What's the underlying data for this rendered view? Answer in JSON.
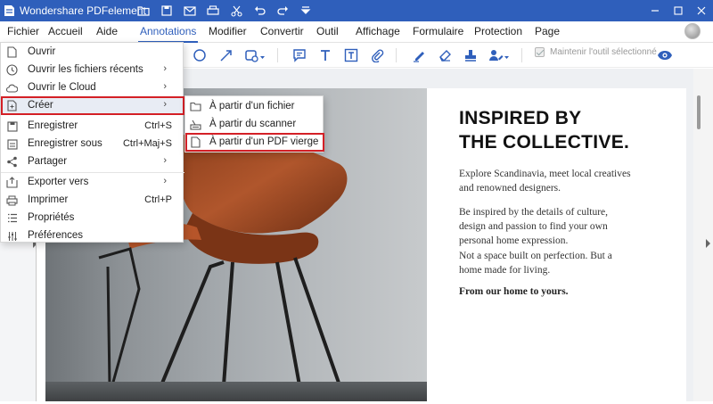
{
  "window": {
    "title": "Wondershare PDFelement"
  },
  "menubar": {
    "items": [
      "Fichier",
      "Accueil",
      "Aide",
      "Annotations",
      "Modifier",
      "Convertir",
      "Outil",
      "Affichage",
      "Formulaire",
      "Protection",
      "Page"
    ],
    "active": "Annotations"
  },
  "toolbar": {
    "keep_tool_label": "Maintenir l'outil sélectionné",
    "tools": [
      "ellipse-icon",
      "arrow-icon",
      "shapes-icon",
      "comment-icon",
      "text-icon",
      "textbox-icon",
      "attachment-icon",
      "highlighter-icon",
      "eraser-icon",
      "stamp-icon",
      "signature-icon",
      "eye-icon"
    ]
  },
  "file_menu": {
    "items": [
      {
        "label": "Ouvrir",
        "icon": "file-icon"
      },
      {
        "label": "Ouvrir les fichiers récents",
        "icon": "clock-icon",
        "submenu": true
      },
      {
        "label": "Ouvrir le Cloud",
        "icon": "cloud-icon",
        "submenu": true
      },
      {
        "label": "Créer",
        "icon": "create-icon",
        "submenu": true,
        "highlighted": true
      },
      {
        "label": "Enregistrer",
        "icon": "save-icon",
        "shortcut": "Ctrl+S"
      },
      {
        "label": "Enregistrer sous",
        "icon": "save-as-icon",
        "shortcut": "Ctrl+Maj+S"
      },
      {
        "label": "Partager",
        "icon": "share-icon",
        "submenu": true
      },
      {
        "label": "Exporter vers",
        "icon": "export-icon",
        "submenu": true
      },
      {
        "label": "Imprimer",
        "icon": "print-icon",
        "shortcut": "Ctrl+P"
      },
      {
        "label": "Propriétés",
        "icon": "list-icon"
      },
      {
        "label": "Préférences",
        "icon": "sliders-icon"
      }
    ]
  },
  "create_submenu": {
    "items": [
      {
        "label": "À partir d'un fichier",
        "icon": "folder-icon"
      },
      {
        "label": "À partir du scanner",
        "icon": "scanner-icon"
      },
      {
        "label": "À partir d'un PDF vierge",
        "icon": "blank-page-icon",
        "highlighted": true
      }
    ]
  },
  "document": {
    "title_line1": "INSPIRED BY",
    "title_line2": "THE COLLECTIVE.",
    "para1": "Explore Scandinavia, meet local creatives and renowned designers.",
    "para2": "Be inspired by the details of culture, design and passion to find your own personal home expression.",
    "para3": "Not a space built on perfection. But a home made for living.",
    "closing": "From our home to yours."
  },
  "colors": {
    "accent": "#2f5fbb",
    "highlight_box": "#d42026",
    "chair_leather": "#b0562c"
  }
}
